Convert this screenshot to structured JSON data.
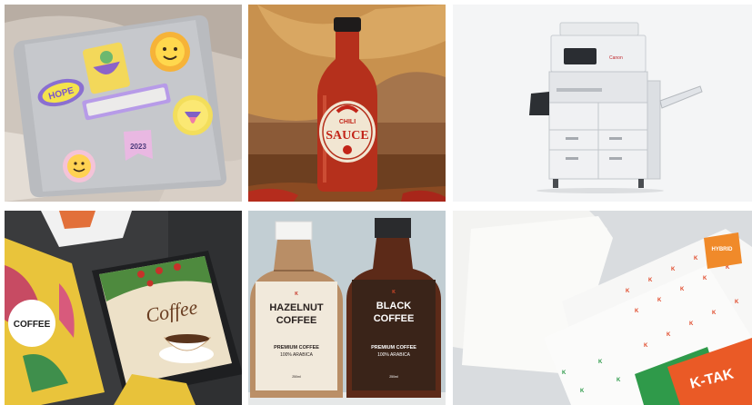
{
  "tiles": [
    {
      "name": "laptop-stickers-photo",
      "text": {
        "hope": "HOPE",
        "sticker_2023": "2023"
      }
    },
    {
      "name": "chili-sauce-bottle-photo",
      "text": {
        "chili": "CHILI",
        "sauce": "SAUCE"
      }
    },
    {
      "name": "printer-photo",
      "text": {
        "brand": "Canon"
      }
    },
    {
      "name": "coffee-pouch-photo",
      "text": {
        "coffee_label": "COFFEE",
        "coffee_script": "Coffee"
      }
    },
    {
      "name": "coffee-bottles-photo",
      "text": {
        "left_line1": "HAZELNUT",
        "left_line2": "COFFEE",
        "left_sub1": "PREMIUM COFFEE",
        "left_sub2": "100% ARABICA",
        "left_vol": "250ml",
        "right_line1": "BLACK",
        "right_line2": "COFFEE",
        "right_sub1": "PREMIUM COFFEE",
        "right_sub2": "100% ARABICA",
        "right_vol": "250ml"
      }
    },
    {
      "name": "label-sheets-photo",
      "text": {
        "brand": "K-TAK",
        "hybrid": "HYBRID"
      }
    }
  ]
}
